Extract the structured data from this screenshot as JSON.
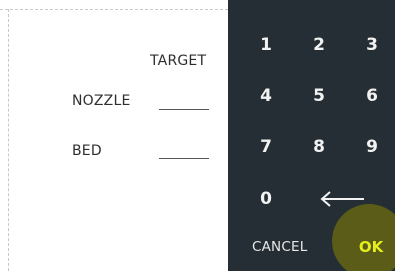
{
  "form": {
    "header_label": "TARGET",
    "rows": [
      {
        "label": "NOZZLE",
        "value": ""
      },
      {
        "label": "BED",
        "value": ""
      }
    ]
  },
  "keypad": {
    "keys": [
      "1",
      "2",
      "3",
      "4",
      "5",
      "6",
      "7",
      "8",
      "9",
      "0"
    ],
    "backspace_icon": "left-arrow-icon",
    "cancel_label": "CANCEL",
    "ok_label": "OK"
  },
  "colors": {
    "keypad_background": "#242e34",
    "ok_accent": "#e6ef1c",
    "ok_highlight": "#5a5c17"
  }
}
